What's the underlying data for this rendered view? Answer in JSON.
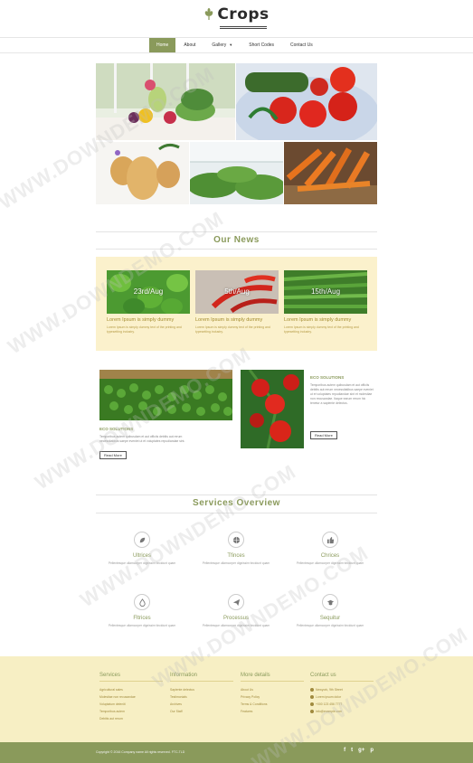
{
  "brand": {
    "name": "Crops"
  },
  "nav": {
    "items": [
      {
        "label": "Home",
        "active": true
      },
      {
        "label": "About"
      },
      {
        "label": "Gallery"
      },
      {
        "label": "Short Codes"
      },
      {
        "label": "Contact Us"
      }
    ]
  },
  "news": {
    "title": "Our News",
    "cards": [
      {
        "date": "23rd/Aug",
        "title": "Lorem Ipsum is simply dummy",
        "text": "Lorem Ipsum is simply dummy text of the printing and typesetting industry."
      },
      {
        "date": "5th/Aug",
        "title": "Lorem Ipsum is simply dummy",
        "text": "Lorem Ipsum is simply dummy text of the printing and typesetting industry."
      },
      {
        "date": "15th/Aug",
        "title": "Lorem Ipsum is simply dummy",
        "text": "Lorem Ipsum is simply dummy text of the printing and typesetting industry."
      }
    ]
  },
  "eco": {
    "left": {
      "label": "ECO SOLUTIONS",
      "text": "Temporibus autem quibusdam et aut officiis debitis aut rerum necessitatibus saepe eveniet ut et voluptates repudiandae sint.",
      "button": "Read More"
    },
    "right": {
      "label": "ECO SOLUTIONS",
      "text": "Temporibus autem quibusdam et aut officiis debitis aut rerum necessitatibus saepe eveniet ut et voluptates repudiandae sint et molestiae non recusandae. Itaque earum rerum hic tenetur a sapiente delectus.",
      "button": "Read More"
    }
  },
  "services": {
    "title": "Services Overview",
    "items": [
      {
        "name": "Ultrices",
        "icon": "leaf-icon",
        "text": "Pellentesque ullamcorper dignissim tincidunt quam"
      },
      {
        "name": "Tfinces",
        "icon": "globe-icon",
        "text": "Pellentesque ullamcorper dignissim tincidunt quam"
      },
      {
        "name": "Chrices",
        "icon": "thumbs-up-icon",
        "text": "Pellentesque ullamcorper dignissim tincidunt quam"
      },
      {
        "name": "Fltrices",
        "icon": "drop-icon",
        "text": "Pellentesque ullamcorper dignissim tincidunt quam"
      },
      {
        "name": "Processus",
        "icon": "paper-plane-icon",
        "text": "Pellentesque ullamcorper dignissim tincidunt quam"
      },
      {
        "name": "Sequitur",
        "icon": "graduation-cap-icon",
        "text": "Pellentesque ullamcorper dignissim tincidunt quam"
      }
    ]
  },
  "footer": {
    "columns": [
      {
        "heading": "Services",
        "links": [
          "Agricultural sales",
          "Molestiae non recusandae",
          "Voluptatum deleniti",
          "Temporibus autem",
          "Debitis aut rerum"
        ]
      },
      {
        "heading": "Information",
        "links": [
          "Sapiente delectus",
          "Testimonials",
          "Archives",
          "Our Staff"
        ]
      },
      {
        "heading": "More details",
        "links": [
          "About Us",
          "Privacy Policy",
          "Terms & Conditions",
          "Features"
        ]
      },
      {
        "heading": "Contact us",
        "links": [
          "Newyork, 9th Street",
          "Lorem ipsum dolor",
          "+000 123 456 7777",
          "info@example.com"
        ]
      }
    ],
    "copyright": "Copyright © 2016 Company name All rights reserved. FTC-TLD",
    "socials": [
      "f",
      "t",
      "g+",
      "p"
    ]
  },
  "watermark": "WWW.DOWNDEMO.COM",
  "colors": {
    "accent": "#8a9a5b",
    "band": "#fbf1cc",
    "footer": "#f7efc4"
  }
}
